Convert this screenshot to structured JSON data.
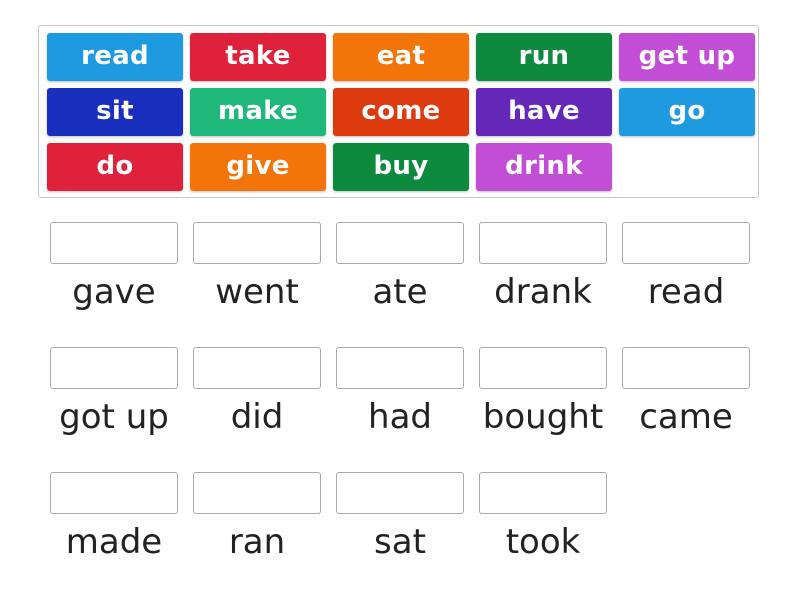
{
  "tiles": [
    {
      "label": "read",
      "color": "#1e9be0"
    },
    {
      "label": "take",
      "color": "#e0213b"
    },
    {
      "label": "eat",
      "color": "#f37509"
    },
    {
      "label": "run",
      "color": "#0e8a3e"
    },
    {
      "label": "get up",
      "color": "#c24ed6"
    },
    {
      "label": "sit",
      "color": "#1b2fbf"
    },
    {
      "label": "make",
      "color": "#1db87a"
    },
    {
      "label": "come",
      "color": "#de3a10"
    },
    {
      "label": "have",
      "color": "#6527b8"
    },
    {
      "label": "go",
      "color": "#1e9be0"
    },
    {
      "label": "do",
      "color": "#e0213b"
    },
    {
      "label": "give",
      "color": "#f37509"
    },
    {
      "label": "buy",
      "color": "#0e8a3e"
    },
    {
      "label": "drink",
      "color": "#c24ed6"
    }
  ],
  "targets": [
    {
      "label": "gave",
      "value": ""
    },
    {
      "label": "went",
      "value": ""
    },
    {
      "label": "ate",
      "value": ""
    },
    {
      "label": "drank",
      "value": ""
    },
    {
      "label": "read",
      "value": ""
    },
    {
      "label": "got up",
      "value": ""
    },
    {
      "label": "did",
      "value": ""
    },
    {
      "label": "had",
      "value": ""
    },
    {
      "label": "bought",
      "value": ""
    },
    {
      "label": "came",
      "value": ""
    },
    {
      "label": "made",
      "value": ""
    },
    {
      "label": "ran",
      "value": ""
    },
    {
      "label": "sat",
      "value": ""
    },
    {
      "label": "took",
      "value": ""
    }
  ]
}
